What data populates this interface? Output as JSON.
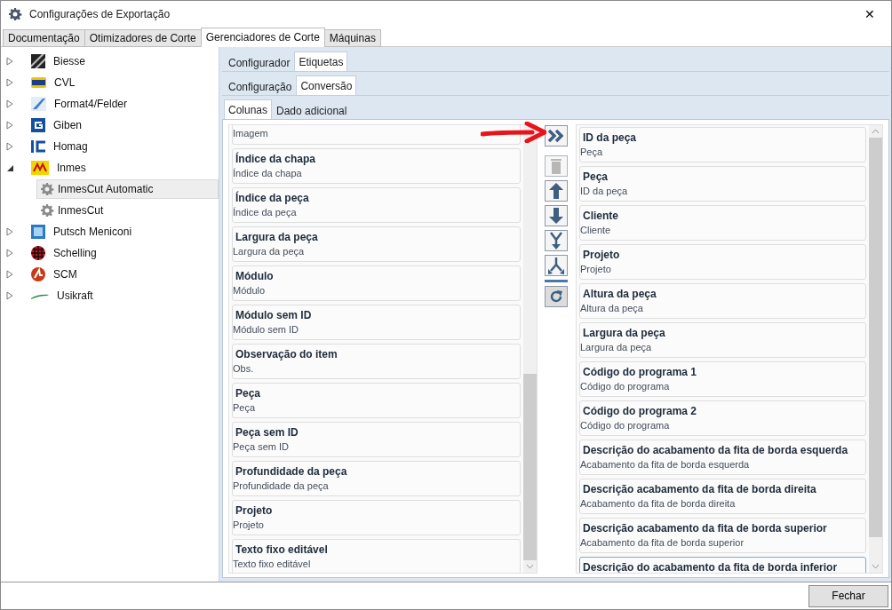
{
  "window": {
    "title": "Configurações de Exportação",
    "close": "✕"
  },
  "main_tabs": [
    {
      "label": "Documentação",
      "selected": false
    },
    {
      "label": "Otimizadores de Corte",
      "selected": false
    },
    {
      "label": "Gerenciadores de Corte",
      "selected": true
    },
    {
      "label": "Máquinas",
      "selected": false
    }
  ],
  "tree": [
    {
      "label": "Biesse",
      "expanded": false,
      "selected": false
    },
    {
      "label": "CVL",
      "expanded": false,
      "selected": false
    },
    {
      "label": "Format4/Felder",
      "expanded": false,
      "selected": false
    },
    {
      "label": "Giben",
      "expanded": false,
      "selected": false
    },
    {
      "label": "Homag",
      "expanded": false,
      "selected": false
    },
    {
      "label": "Inmes",
      "expanded": true,
      "selected": false,
      "children": [
        {
          "label": "InmesCut Automatic",
          "selected": true
        },
        {
          "label": "InmesCut",
          "selected": false
        }
      ]
    },
    {
      "label": "Putsch Meniconi",
      "expanded": false,
      "selected": false
    },
    {
      "label": "Schelling",
      "expanded": false,
      "selected": false
    },
    {
      "label": "SCM",
      "expanded": false,
      "selected": false
    },
    {
      "label": "Usikraft",
      "expanded": false,
      "selected": false
    }
  ],
  "tabs_level1": [
    {
      "label": "Configurador",
      "selected": false
    },
    {
      "label": "Etiquetas",
      "selected": true
    }
  ],
  "tabs_level2": [
    {
      "label": "Configuração",
      "selected": false
    },
    {
      "label": "Conversão",
      "selected": true
    }
  ],
  "tabs_level3": [
    {
      "label": "Colunas",
      "selected": true
    },
    {
      "label": "Dado adicional",
      "selected": false
    }
  ],
  "available_columns": [
    {
      "subtitle": "Imagem"
    },
    {
      "title": "Índice da chapa",
      "subtitle": "Índice da chapa"
    },
    {
      "title": "Índice da peça",
      "subtitle": "Índice da peça"
    },
    {
      "title": "Largura da peça",
      "subtitle": "Largura da peça"
    },
    {
      "title": "Módulo",
      "subtitle": "Módulo"
    },
    {
      "title": "Módulo sem ID",
      "subtitle": "Módulo sem ID"
    },
    {
      "title": "Observação do item",
      "subtitle": "Obs."
    },
    {
      "title": "Peça",
      "subtitle": "Peça"
    },
    {
      "title": "Peça sem ID",
      "subtitle": "Peça sem ID"
    },
    {
      "title": "Profundidade da peça",
      "subtitle": "Profundidade da peça"
    },
    {
      "title": "Projeto",
      "subtitle": "Projeto"
    },
    {
      "title": "Texto fixo editável",
      "subtitle": "Texto fixo editável"
    }
  ],
  "tools": [
    {
      "kind": "add",
      "disabled": false
    },
    {
      "kind": "delete",
      "disabled": true
    },
    {
      "kind": "up",
      "disabled": false
    },
    {
      "kind": "down",
      "disabled": false
    },
    {
      "kind": "merge",
      "disabled": false
    },
    {
      "kind": "split",
      "disabled": false
    },
    {
      "kind": "reset",
      "disabled": false
    }
  ],
  "selected_columns": [
    {
      "title": "ID da peça",
      "subtitle": "Peça",
      "selected": false
    },
    {
      "title": "Peça",
      "subtitle": "ID da peça",
      "selected": false
    },
    {
      "title": "Cliente",
      "subtitle": "Cliente",
      "selected": false
    },
    {
      "title": "Projeto",
      "subtitle": "Projeto",
      "selected": false
    },
    {
      "title": "Altura da peça",
      "subtitle": "Altura da peça",
      "selected": false
    },
    {
      "title": "Largura da peça",
      "subtitle": "Largura da peça",
      "selected": false
    },
    {
      "title": "Código do programa 1",
      "subtitle": "Código do programa",
      "selected": false
    },
    {
      "title": "Código do programa 2",
      "subtitle": "Código do programa",
      "selected": false
    },
    {
      "title": "Descrição do acabamento da fita de borda esquerda",
      "subtitle": "Acabamento da fita de borda esquerda",
      "selected": false
    },
    {
      "title": "Descrição acabamento da fita de borda direita",
      "subtitle": "Acabamento da fita de borda direita",
      "selected": false
    },
    {
      "title": "Descrição acabamento da fita de borda superior",
      "subtitle": "Acabamento da fita de borda superior",
      "selected": false
    },
    {
      "title": "Descrição do acabamento da fita de borda inferior",
      "selected": true
    }
  ],
  "footer": {
    "close_button": "Fechar"
  }
}
